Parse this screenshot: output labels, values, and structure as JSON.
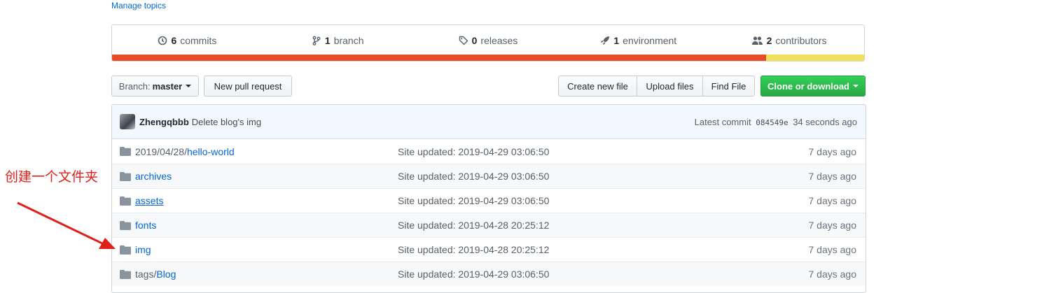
{
  "manage_topics": "Manage topics",
  "summary": {
    "commits": {
      "num": "6",
      "label": "commits"
    },
    "branch": {
      "num": "1",
      "label": "branch"
    },
    "releases": {
      "num": "0",
      "label": "releases"
    },
    "environment": {
      "num": "1",
      "label": "environment"
    },
    "contributors": {
      "num": "2",
      "label": "contributors"
    }
  },
  "language_bar": [
    {
      "color": "#e34c26",
      "fraction": 0.87
    },
    {
      "color": "#f1e05a",
      "fraction": 0.13
    }
  ],
  "toolbar": {
    "branch_prefix": "Branch:",
    "branch_name": "master",
    "new_pull_request": "New pull request",
    "create_new_file": "Create new file",
    "upload_files": "Upload files",
    "find_file": "Find File",
    "clone_or_download": "Clone or download"
  },
  "commit": {
    "author": "Zhengqbbb",
    "message": "Delete blog's img",
    "latest_label": "Latest commit",
    "sha": "084549e",
    "time": "34 seconds ago"
  },
  "files": [
    {
      "prefix": "2019/04/28/",
      "name": "hello-world",
      "message": "Site updated: 2019-04-29 03:06:50",
      "age": "7 days ago"
    },
    {
      "prefix": "",
      "name": "archives",
      "message": "Site updated: 2019-04-29 03:06:50",
      "age": "7 days ago"
    },
    {
      "prefix": "",
      "name": "assets",
      "message": "Site updated: 2019-04-29 03:06:50",
      "age": "7 days ago"
    },
    {
      "prefix": "",
      "name": "fonts",
      "message": "Site updated: 2019-04-28 20:25:12",
      "age": "7 days ago"
    },
    {
      "prefix": "",
      "name": "img",
      "message": "Site updated: 2019-04-28 20:25:12",
      "age": "7 days ago"
    },
    {
      "prefix": "tags/",
      "name": "Blog",
      "message": "Site updated: 2019-04-29 03:06:50",
      "age": "7 days ago"
    }
  ],
  "annotation": {
    "text": "创建一个文件夹",
    "color": "#e0201b"
  },
  "colors": {
    "link": "#0366d6",
    "green": "#28a745",
    "commit_bg": "#f1f8ff"
  }
}
